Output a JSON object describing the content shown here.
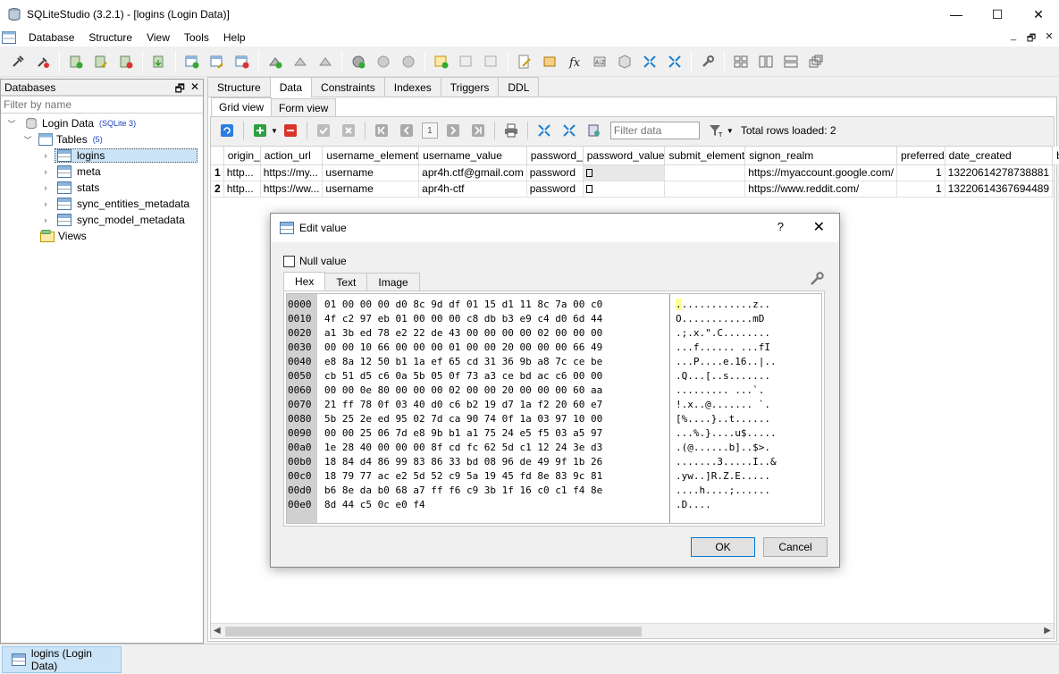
{
  "window": {
    "title": "SQLiteStudio (3.2.1) - [logins (Login Data)]",
    "minimize": "—",
    "maximize": "☐",
    "close": "✕"
  },
  "menu": [
    "Database",
    "Structure",
    "View",
    "Tools",
    "Help"
  ],
  "mdi": {
    "minimize": "_",
    "restore": "🗗",
    "close": "✕"
  },
  "db_panel": {
    "title": "Databases",
    "filter_placeholder": "Filter by name",
    "database": {
      "label": "Login Data",
      "tag": "(SQLite 3)"
    },
    "tables": {
      "label": "Tables",
      "count": "(5)"
    },
    "table_items": [
      "logins",
      "meta",
      "stats",
      "sync_entities_metadata",
      "sync_model_metadata"
    ],
    "views_label": "Views"
  },
  "tabs": [
    "Structure",
    "Data",
    "Constraints",
    "Indexes",
    "Triggers",
    "DDL"
  ],
  "subtabs": [
    "Grid view",
    "Form view"
  ],
  "grid_toolbar": {
    "page": "1",
    "filter_placeholder": "Filter data",
    "total_rows": "Total rows loaded: 2"
  },
  "grid": {
    "columns": [
      "origin_",
      "action_url",
      "username_element",
      "username_value",
      "password_",
      "password_value",
      "submit_element",
      "signon_realm",
      "preferred",
      "date_created",
      "b"
    ],
    "rows": [
      {
        "num": "1",
        "cells": [
          "http...",
          "https://my...",
          "username",
          "apr4h.ctf@gmail.com",
          "password",
          "",
          "",
          "https://myaccount.google.com/",
          "1",
          "13220614278738881",
          ""
        ]
      },
      {
        "num": "2",
        "cells": [
          "http...",
          "https://ww...",
          "username",
          "apr4h-ctf",
          "password",
          "",
          "",
          "https://www.reddit.com/",
          "1",
          "13220614367694489",
          ""
        ]
      }
    ]
  },
  "bottom": {
    "window_tab": "logins (Login Data)"
  },
  "dialog": {
    "title": "Edit value",
    "help": "?",
    "close": "✕",
    "null_label": "Null value",
    "tabs": [
      "Hex",
      "Text",
      "Image"
    ],
    "offsets": [
      "0000",
      "0010",
      "0020",
      "0030",
      "0040",
      "0050",
      "0060",
      "0070",
      "0080",
      "0090",
      "00a0",
      "00b0",
      "00c0",
      "00d0",
      "00e0"
    ],
    "hex_lines": [
      "01 00 00 00 d0 8c 9d df 01 15 d1 11 8c 7a 00 c0",
      "4f c2 97 eb 01 00 00 00 c8 db b3 e9 c4 d0 6d 44",
      "a1 3b ed 78 e2 22 de 43 00 00 00 00 02 00 00 00",
      "00 00 10 66 00 00 00 01 00 00 20 00 00 00 66 49",
      "e8 8a 12 50 b1 1a ef 65 cd 31 36 9b a8 7c ce be",
      "cb 51 d5 c6 0a 5b 05 0f 73 a3 ce bd ac c6 00 00",
      "00 00 0e 80 00 00 00 02 00 00 20 00 00 00 60 aa",
      "21 ff 78 0f 03 40 d0 c6 b2 19 d7 1a f2 20 60 e7",
      "5b 25 2e ed 95 02 7d ca 90 74 0f 1a 03 97 10 00",
      "00 00 25 06 7d e8 9b b1 a1 75 24 e5 f5 03 a5 97",
      "1e 28 40 00 00 00 8f cd fc 62 5d c1 12 24 3e d3",
      "18 84 d4 86 99 83 86 33 bd 08 96 de 49 9f 1b 26",
      "18 79 77 ac e2 5d 52 c9 5a 19 45 fd 8e 83 9c 81",
      "b6 8e da b0 68 a7 ff f6 c9 3b 1f 16 c0 c1 f4 8e",
      "8d 44 c5 0c e0 f4"
    ],
    "ascii_lines": [
      ".............z..",
      "O............mD",
      ".;.x.\".C........",
      "...f...... ...fI",
      "...P....e.16..|..",
      ".Q...[..s.......",
      "......... ...`.",
      "!.x..@....... `.",
      "[%....}..t......",
      "...%.}....u$.....",
      ".(@......b]..$>.",
      ".......3.....I..&",
      ".yw..]R.Z.E.....",
      "....h....;......",
      ".D...."
    ],
    "ok": "OK",
    "cancel": "Cancel"
  }
}
